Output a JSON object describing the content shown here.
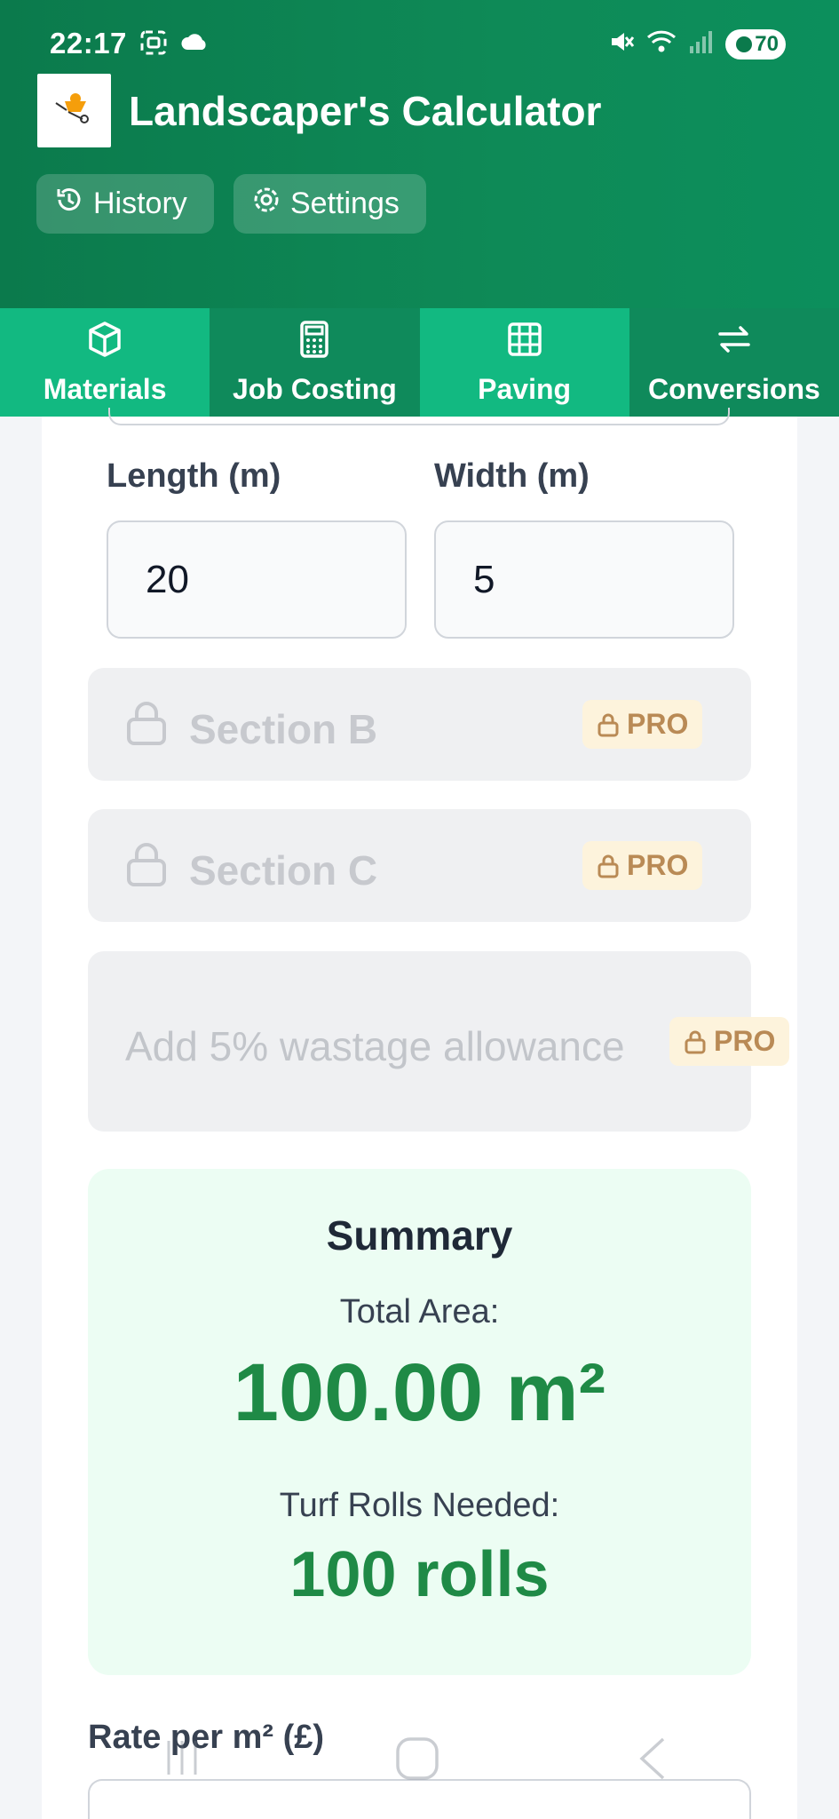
{
  "status_bar": {
    "time": "22:17",
    "battery": "70",
    "icons": [
      "screenshot-icon",
      "cloud-icon",
      "mute-icon",
      "wifi-icon",
      "signal-icon"
    ]
  },
  "app": {
    "title": "Landscaper's Calculator",
    "logo": "wheelbarrow-icon",
    "history_label": "History",
    "settings_label": "Settings"
  },
  "tabs": [
    {
      "label": "Materials",
      "icon": "cube-icon"
    },
    {
      "label": "Job Costing",
      "icon": "calculator-icon"
    },
    {
      "label": "Paving",
      "icon": "grid-icon"
    },
    {
      "label": "Conversions",
      "icon": "swap-icon"
    }
  ],
  "section_a": {
    "length_label": "Length (m)",
    "length_value": "20",
    "width_label": "Width (m)",
    "width_value": "5"
  },
  "section_b": {
    "label": "Section B",
    "badge": "PRO"
  },
  "section_c": {
    "label": "Section C",
    "badge": "PRO"
  },
  "wastage": {
    "label": "Add 5% wastage allowance",
    "badge": "PRO"
  },
  "summary": {
    "title": "Summary",
    "area_label": "Total Area:",
    "area_value": "100.00 m²",
    "rolls_label": "Turf Rolls Needed:",
    "rolls_value": "100 rolls"
  },
  "rate": {
    "label": "Rate per m² (£)"
  },
  "colors": {
    "header": "#0b7a4c",
    "tab_light": "#12b981",
    "tab_dark": "#0f8a5b",
    "result_green": "#1f8a46",
    "pro_badge_bg": "#fdf3dc",
    "pro_badge_text": "#b98a55"
  }
}
